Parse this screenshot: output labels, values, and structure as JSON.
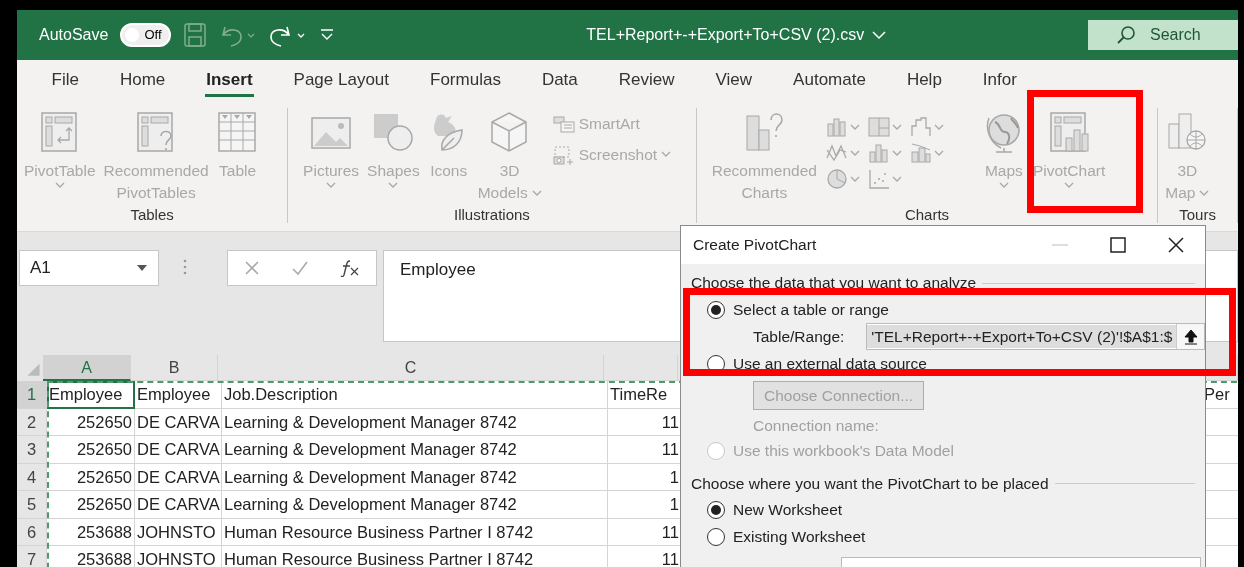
{
  "title_bar": {
    "autosave_label": "AutoSave",
    "autosave_toggle": {
      "label": "Off",
      "on": false
    },
    "document_title": "TEL+Report+-+Export+To+CSV (2).csv",
    "search": {
      "placeholder": "Search"
    }
  },
  "menu_tabs": [
    {
      "label": "File",
      "selected": false
    },
    {
      "label": "Home",
      "selected": false
    },
    {
      "label": "Insert",
      "selected": true
    },
    {
      "label": "Page Layout",
      "selected": false
    },
    {
      "label": "Formulas",
      "selected": false
    },
    {
      "label": "Data",
      "selected": false
    },
    {
      "label": "Review",
      "selected": false
    },
    {
      "label": "View",
      "selected": false
    },
    {
      "label": "Automate",
      "selected": false
    },
    {
      "label": "Help",
      "selected": false
    },
    {
      "label": "Infor",
      "selected": false
    }
  ],
  "ribbon": {
    "disabled": true,
    "groups": [
      {
        "label": "Tables",
        "items": [
          {
            "kind": "large",
            "lines": [
              "PivotTable"
            ],
            "dropdown": true
          },
          {
            "kind": "large",
            "lines": [
              "Recommended",
              "PivotTables"
            ],
            "dropdown": false
          },
          {
            "kind": "large",
            "lines": [
              "Table"
            ],
            "dropdown": false
          }
        ]
      },
      {
        "label": "Illustrations",
        "items": [
          {
            "kind": "large",
            "lines": [
              "Pictures"
            ],
            "dropdown": true
          },
          {
            "kind": "large",
            "lines": [
              "Shapes"
            ],
            "dropdown": true
          },
          {
            "kind": "large",
            "lines": [
              "Icons"
            ],
            "dropdown": false
          },
          {
            "kind": "large",
            "lines": [
              "3D",
              "Models"
            ],
            "dropdown": true
          },
          {
            "kind": "stack",
            "buttons": [
              {
                "label": "SmartArt",
                "dropdown": false
              },
              {
                "label": "Screenshot",
                "dropdown": true
              }
            ]
          }
        ]
      },
      {
        "label": "Charts",
        "items": [
          {
            "kind": "large",
            "lines": [
              "Recommended",
              "Charts"
            ],
            "dropdown": false
          },
          {
            "kind": "gallery"
          },
          {
            "kind": "large",
            "lines": [
              "Maps"
            ],
            "dropdown": true
          },
          {
            "kind": "large",
            "lines": [
              "PivotChart"
            ],
            "dropdown": true
          }
        ]
      },
      {
        "label": "Tours",
        "items": [
          {
            "kind": "large",
            "lines": [
              "3D",
              "Map"
            ],
            "dropdown": true
          }
        ]
      }
    ]
  },
  "formula_bar": {
    "name_box": "A1",
    "formula": "Employee"
  },
  "sheet": {
    "columns": [
      {
        "letter": "A",
        "selected": true
      },
      {
        "letter": "B",
        "selected": false
      },
      {
        "letter": "C",
        "selected": false
      }
    ],
    "rows": [
      {
        "number": "1",
        "selected": true,
        "cells": [
          {
            "text": "Employee",
            "kind": "text"
          },
          {
            "text": "Employee",
            "kind": "text"
          },
          {
            "text": "Job.Description",
            "kind": "text"
          },
          {
            "text": "TimeRe",
            "kind": "text"
          }
        ],
        "far_right_cell": "Per"
      },
      {
        "number": "2",
        "selected": false,
        "cells": [
          {
            "text": "252650",
            "kind": "number"
          },
          {
            "text": "DE CARVA",
            "kind": "text"
          },
          {
            "text": "Learning & Development Manager 8742",
            "kind": "text"
          },
          {
            "text": "11",
            "kind": "number"
          }
        ]
      },
      {
        "number": "3",
        "selected": false,
        "cells": [
          {
            "text": "252650",
            "kind": "number"
          },
          {
            "text": "DE CARVA",
            "kind": "text"
          },
          {
            "text": "Learning & Development Manager 8742",
            "kind": "text"
          },
          {
            "text": "11",
            "kind": "number"
          }
        ]
      },
      {
        "number": "4",
        "selected": false,
        "cells": [
          {
            "text": "252650",
            "kind": "number"
          },
          {
            "text": "DE CARVA",
            "kind": "text"
          },
          {
            "text": "Learning & Development Manager 8742",
            "kind": "text"
          },
          {
            "text": "1",
            "kind": "number"
          }
        ]
      },
      {
        "number": "5",
        "selected": false,
        "cells": [
          {
            "text": "252650",
            "kind": "number"
          },
          {
            "text": "DE CARVA",
            "kind": "text"
          },
          {
            "text": "Learning & Development Manager 8742",
            "kind": "text"
          },
          {
            "text": "1",
            "kind": "number"
          }
        ]
      },
      {
        "number": "6",
        "selected": false,
        "cells": [
          {
            "text": "253688",
            "kind": "number"
          },
          {
            "text": "JOHNSTO",
            "kind": "text"
          },
          {
            "text": "Human Resource Business Partner I 8742",
            "kind": "text"
          },
          {
            "text": "11",
            "kind": "number"
          }
        ]
      },
      {
        "number": "7",
        "selected": false,
        "cells": [
          {
            "text": "253688",
            "kind": "number"
          },
          {
            "text": "JOHNSTO",
            "kind": "text"
          },
          {
            "text": "Human Resource Business Partner I 8742",
            "kind": "text"
          },
          {
            "text": "11",
            "kind": "number"
          }
        ]
      }
    ]
  },
  "dialog": {
    "title": "Create PivotChart",
    "sections": [
      {
        "heading": "Choose the data that you want to analyze",
        "options": [
          {
            "kind": "radio",
            "label": "Select a table or range",
            "selected": true,
            "disabled": false
          },
          {
            "kind": "range-field",
            "label": "Table/Range:",
            "value": "'TEL+Report+-+Export+To+CSV (2)'!$A$1:$"
          },
          {
            "kind": "radio",
            "label": "Use an external data source",
            "selected": false,
            "disabled": false
          },
          {
            "kind": "button",
            "label": "Choose Connection...",
            "disabled": true
          },
          {
            "kind": "note",
            "label": "Connection name:",
            "disabled": true
          },
          {
            "kind": "radio",
            "label": "Use this workbook's Data Model",
            "selected": false,
            "disabled": true
          }
        ]
      },
      {
        "heading": "Choose where you want the PivotChart to be placed",
        "options": [
          {
            "kind": "radio",
            "label": "New Worksheet",
            "selected": true,
            "disabled": false
          },
          {
            "kind": "radio",
            "label": "Existing Worksheet",
            "selected": false,
            "disabled": false
          },
          {
            "kind": "location-field"
          }
        ]
      }
    ]
  }
}
